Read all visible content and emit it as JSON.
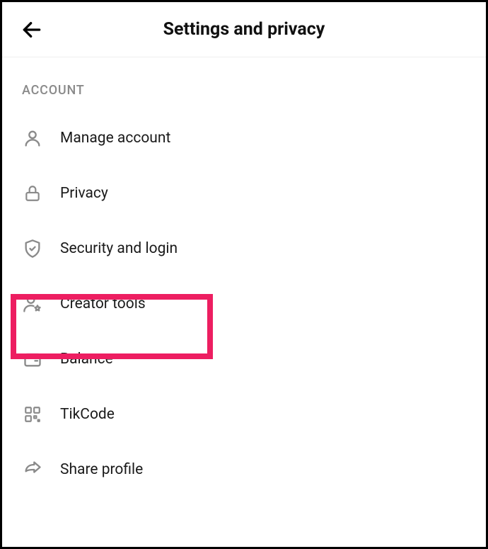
{
  "header": {
    "title": "Settings and privacy"
  },
  "section": {
    "label": "ACCOUNT"
  },
  "menu": {
    "items": [
      {
        "label": "Manage account"
      },
      {
        "label": "Privacy"
      },
      {
        "label": "Security and login"
      },
      {
        "label": "Creator tools"
      },
      {
        "label": "Balance"
      },
      {
        "label": "TikCode"
      },
      {
        "label": "Share profile"
      }
    ]
  }
}
